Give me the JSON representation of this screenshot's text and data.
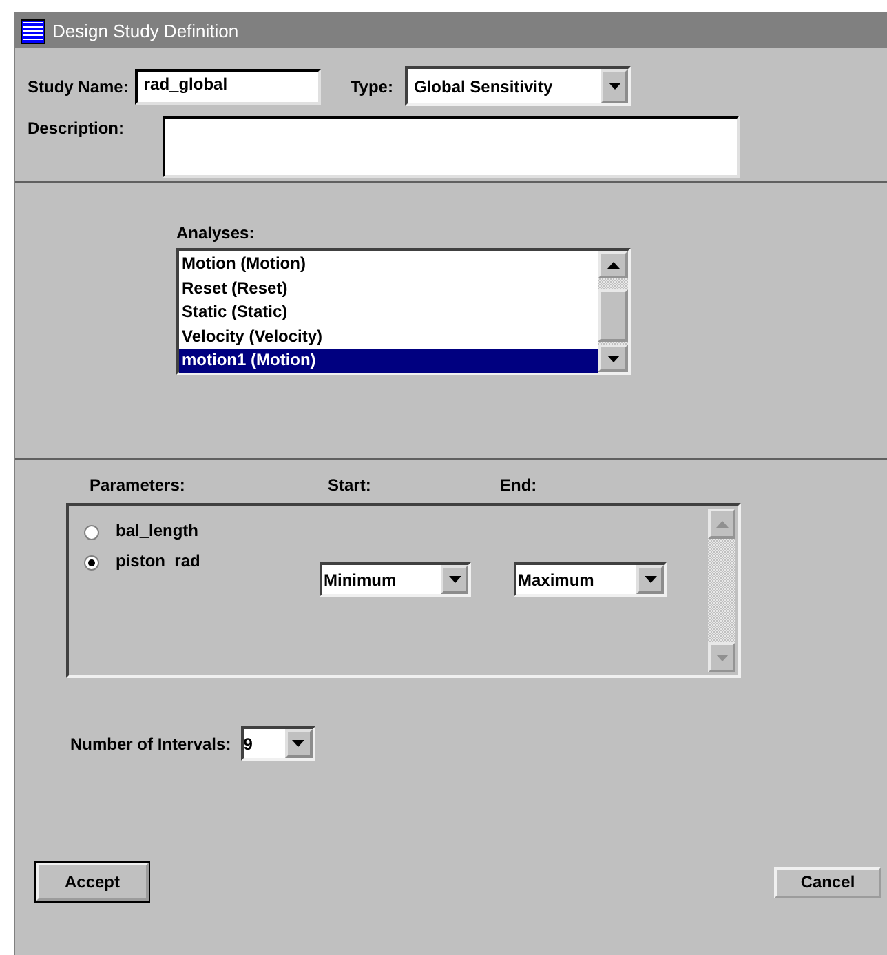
{
  "window": {
    "title": "Design Study Definition"
  },
  "study_name": {
    "label": "Study Name:",
    "value": "rad_global"
  },
  "type": {
    "label": "Type:",
    "value": "Global Sensitivity"
  },
  "description": {
    "label": "Description:"
  },
  "analyses": {
    "label": "Analyses:",
    "items": [
      {
        "label": "Motion (Motion)",
        "selected": false
      },
      {
        "label": "Reset (Reset)",
        "selected": false
      },
      {
        "label": "Static (Static)",
        "selected": false
      },
      {
        "label": "Velocity (Velocity)",
        "selected": false
      },
      {
        "label": "motion1 (Motion)",
        "selected": true
      }
    ]
  },
  "parameters": {
    "headers": [
      "Parameters:",
      "Start:",
      "End:"
    ],
    "rows": [
      {
        "name": "bal_length",
        "selected": false
      },
      {
        "name": "piston_rad",
        "selected": true,
        "start": "Minimum",
        "end": "Maximum"
      }
    ]
  },
  "intervals": {
    "label": "Number of Intervals:",
    "value": "9"
  },
  "buttons": {
    "accept": "Accept",
    "cancel": "Cancel"
  }
}
